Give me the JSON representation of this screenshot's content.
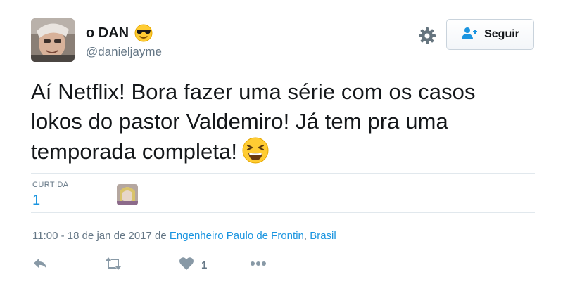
{
  "user": {
    "display_name": "o DAN",
    "handle": "@danieljayme",
    "name_emoji": "smiling-face-with-sunglasses-emoji"
  },
  "header": {
    "follow_label": "Seguir",
    "settings_icon": "gear-icon",
    "follow_icon": "add-user-icon"
  },
  "tweet": {
    "text": "Aí Netflix! Bora fazer uma série com os casos lokos do pastor Valdemiro! Já tem pra uma temporada completa!",
    "emoji": "laughing-face-emoji"
  },
  "stats": {
    "likes_label": "CURTIDA",
    "likes_count": "1"
  },
  "meta": {
    "timestamp": "11:00 - 18 de jan de 2017",
    "from_word": "de",
    "place": "Engenheiro Paulo de Frontin",
    "country": "Brasil"
  },
  "actions": {
    "like_count": "1"
  },
  "colors": {
    "link": "#1b95e0",
    "muted": "#657786",
    "text": "#14171a",
    "divider": "#e1e8ed"
  }
}
